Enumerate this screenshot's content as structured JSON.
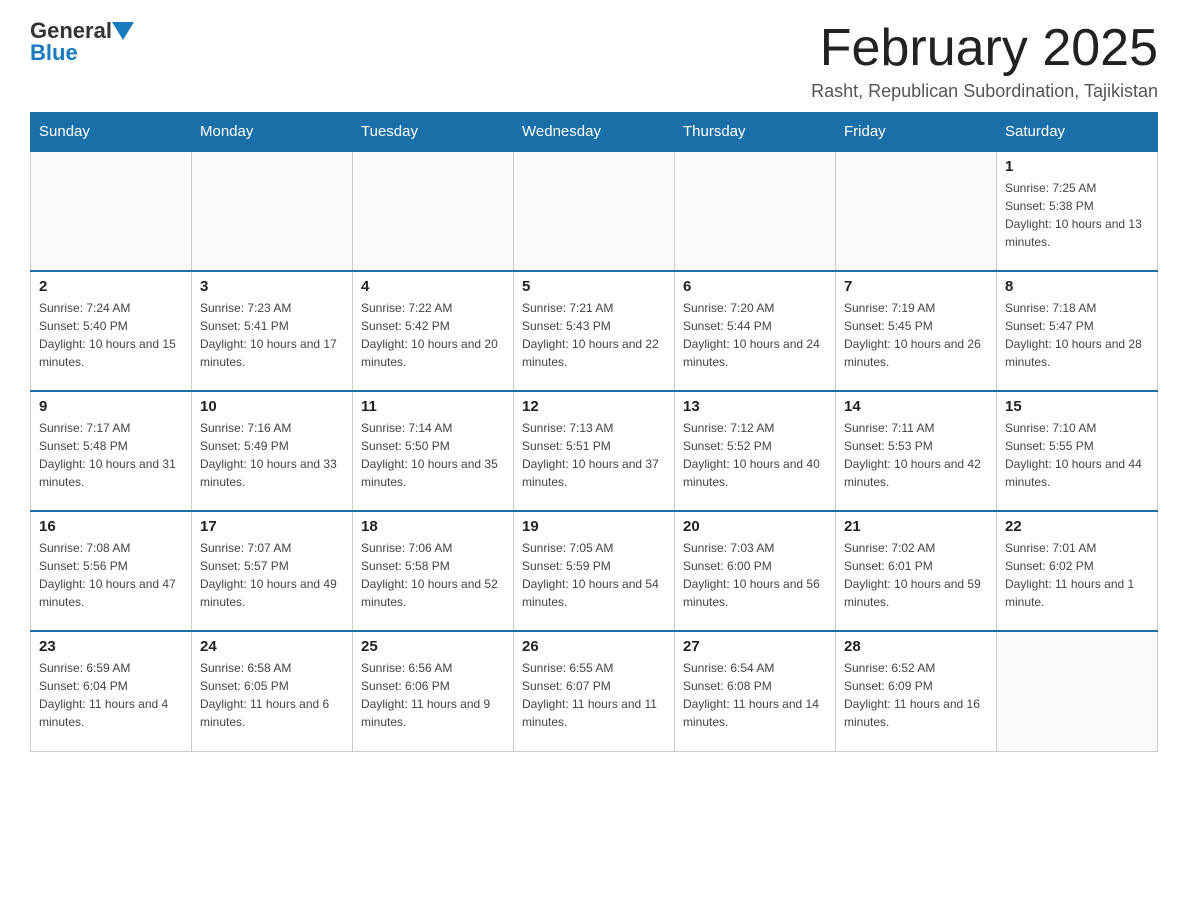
{
  "logo": {
    "general": "General",
    "blue": "Blue",
    "arrow": "▼"
  },
  "title": {
    "month": "February 2025",
    "location": "Rasht, Republican Subordination, Tajikistan"
  },
  "headers": [
    "Sunday",
    "Monday",
    "Tuesday",
    "Wednesday",
    "Thursday",
    "Friday",
    "Saturday"
  ],
  "weeks": [
    [
      {
        "day": "",
        "info": ""
      },
      {
        "day": "",
        "info": ""
      },
      {
        "day": "",
        "info": ""
      },
      {
        "day": "",
        "info": ""
      },
      {
        "day": "",
        "info": ""
      },
      {
        "day": "",
        "info": ""
      },
      {
        "day": "1",
        "info": "Sunrise: 7:25 AM\nSunset: 5:38 PM\nDaylight: 10 hours and 13 minutes."
      }
    ],
    [
      {
        "day": "2",
        "info": "Sunrise: 7:24 AM\nSunset: 5:40 PM\nDaylight: 10 hours and 15 minutes."
      },
      {
        "day": "3",
        "info": "Sunrise: 7:23 AM\nSunset: 5:41 PM\nDaylight: 10 hours and 17 minutes."
      },
      {
        "day": "4",
        "info": "Sunrise: 7:22 AM\nSunset: 5:42 PM\nDaylight: 10 hours and 20 minutes."
      },
      {
        "day": "5",
        "info": "Sunrise: 7:21 AM\nSunset: 5:43 PM\nDaylight: 10 hours and 22 minutes."
      },
      {
        "day": "6",
        "info": "Sunrise: 7:20 AM\nSunset: 5:44 PM\nDaylight: 10 hours and 24 minutes."
      },
      {
        "day": "7",
        "info": "Sunrise: 7:19 AM\nSunset: 5:45 PM\nDaylight: 10 hours and 26 minutes."
      },
      {
        "day": "8",
        "info": "Sunrise: 7:18 AM\nSunset: 5:47 PM\nDaylight: 10 hours and 28 minutes."
      }
    ],
    [
      {
        "day": "9",
        "info": "Sunrise: 7:17 AM\nSunset: 5:48 PM\nDaylight: 10 hours and 31 minutes."
      },
      {
        "day": "10",
        "info": "Sunrise: 7:16 AM\nSunset: 5:49 PM\nDaylight: 10 hours and 33 minutes."
      },
      {
        "day": "11",
        "info": "Sunrise: 7:14 AM\nSunset: 5:50 PM\nDaylight: 10 hours and 35 minutes."
      },
      {
        "day": "12",
        "info": "Sunrise: 7:13 AM\nSunset: 5:51 PM\nDaylight: 10 hours and 37 minutes."
      },
      {
        "day": "13",
        "info": "Sunrise: 7:12 AM\nSunset: 5:52 PM\nDaylight: 10 hours and 40 minutes."
      },
      {
        "day": "14",
        "info": "Sunrise: 7:11 AM\nSunset: 5:53 PM\nDaylight: 10 hours and 42 minutes."
      },
      {
        "day": "15",
        "info": "Sunrise: 7:10 AM\nSunset: 5:55 PM\nDaylight: 10 hours and 44 minutes."
      }
    ],
    [
      {
        "day": "16",
        "info": "Sunrise: 7:08 AM\nSunset: 5:56 PM\nDaylight: 10 hours and 47 minutes."
      },
      {
        "day": "17",
        "info": "Sunrise: 7:07 AM\nSunset: 5:57 PM\nDaylight: 10 hours and 49 minutes."
      },
      {
        "day": "18",
        "info": "Sunrise: 7:06 AM\nSunset: 5:58 PM\nDaylight: 10 hours and 52 minutes."
      },
      {
        "day": "19",
        "info": "Sunrise: 7:05 AM\nSunset: 5:59 PM\nDaylight: 10 hours and 54 minutes."
      },
      {
        "day": "20",
        "info": "Sunrise: 7:03 AM\nSunset: 6:00 PM\nDaylight: 10 hours and 56 minutes."
      },
      {
        "day": "21",
        "info": "Sunrise: 7:02 AM\nSunset: 6:01 PM\nDaylight: 10 hours and 59 minutes."
      },
      {
        "day": "22",
        "info": "Sunrise: 7:01 AM\nSunset: 6:02 PM\nDaylight: 11 hours and 1 minute."
      }
    ],
    [
      {
        "day": "23",
        "info": "Sunrise: 6:59 AM\nSunset: 6:04 PM\nDaylight: 11 hours and 4 minutes."
      },
      {
        "day": "24",
        "info": "Sunrise: 6:58 AM\nSunset: 6:05 PM\nDaylight: 11 hours and 6 minutes."
      },
      {
        "day": "25",
        "info": "Sunrise: 6:56 AM\nSunset: 6:06 PM\nDaylight: 11 hours and 9 minutes."
      },
      {
        "day": "26",
        "info": "Sunrise: 6:55 AM\nSunset: 6:07 PM\nDaylight: 11 hours and 11 minutes."
      },
      {
        "day": "27",
        "info": "Sunrise: 6:54 AM\nSunset: 6:08 PM\nDaylight: 11 hours and 14 minutes."
      },
      {
        "day": "28",
        "info": "Sunrise: 6:52 AM\nSunset: 6:09 PM\nDaylight: 11 hours and 16 minutes."
      },
      {
        "day": "",
        "info": ""
      }
    ]
  ]
}
